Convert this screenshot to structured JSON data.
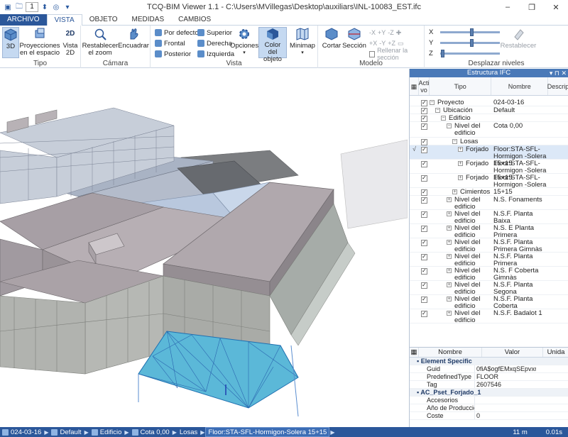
{
  "titlebar": {
    "title": "TCQ-BIM Viewer 1.1 - C:\\Users\\MVillegas\\Desktop\\auxiliars\\INL-10083_EST.ifc",
    "qa_value": "1"
  },
  "tabs": [
    "ARCHIVO",
    "VISTA",
    "OBJETO",
    "MEDIDAS",
    "CAMBIOS"
  ],
  "ribbon": {
    "tipo": {
      "label": "Tipo",
      "b3d": "3D",
      "proyecciones": "Proyecciones en el espacio",
      "vista2d": "Vista 2D",
      "icon2d": "2D"
    },
    "camara": {
      "label": "Cámara",
      "restablecer": "Restablecer el zoom",
      "encuadrar": "Encuadrar"
    },
    "vista": {
      "label": "Vista",
      "por_defecto": "Por defecto",
      "frontal": "Frontal",
      "posterior": "Posterior",
      "superior": "Superior",
      "derecha": "Derecha",
      "izquierda": "Izquierda",
      "opciones": "Opciones",
      "color_objeto": "Color del objeto",
      "minimap": "Minimap"
    },
    "modelo": {
      "label": "Modelo",
      "cortar": "Cortar",
      "seccion": "Sección",
      "x": "+X",
      "y": "+Y",
      "z": "+Z",
      "mx": "-X",
      "my": "-Y",
      "mz": "-Z",
      "rellenar": "Rellenar la sección"
    },
    "desplazar": {
      "label": "Desplazar niveles",
      "x": "X",
      "y": "Y",
      "z": "Z",
      "restablecer": "Restablecer",
      "x_level": 0.52,
      "y_level": 0.52,
      "z_level": 0.02
    }
  },
  "panel": {
    "title": "Estructura IFC",
    "col_activo": "Acti vo",
    "col_tipo": "Tipo",
    "col_nombre": "Nombre",
    "col_desc": "Descrip",
    "rows": [
      {
        "tipo": "Proyecto",
        "nombre": "024-03-16"
      },
      {
        "tipo": "Ubicación",
        "nombre": "Default"
      },
      {
        "tipo": "Edificio",
        "nombre": ""
      },
      {
        "tipo": "Nivel del edificio",
        "nombre": "Cota 0,00"
      },
      {
        "tipo": "Losas",
        "nombre": ""
      },
      {
        "tipo": "Forjado",
        "nombre": "Floor:STA-SFL-Hormigon -Solera 15+15"
      },
      {
        "tipo": "Forjado",
        "nombre": "Floor:STA-SFL-Hormigon -Solera 15+15"
      },
      {
        "tipo": "Forjado",
        "nombre": "Floor:STA-SFL-Hormigon -Solera 15+15"
      },
      {
        "tipo": "Cimientos",
        "nombre": ""
      },
      {
        "tipo": "Nivel del edificio",
        "nombre": "N.S. Fonaments"
      },
      {
        "tipo": "Nivel del edificio",
        "nombre": "N.S.F. Planta Baixa"
      },
      {
        "tipo": "Nivel del edificio",
        "nombre": "N.S. E Planta Primera"
      },
      {
        "tipo": "Nivel del edificio",
        "nombre": "N.S.F. Planta Primera Gimnàs"
      },
      {
        "tipo": "Nivel del edificio",
        "nombre": "N.S.F. Planta Primera"
      },
      {
        "tipo": "Nivel del edificio",
        "nombre": "N.S. F Coberta Gimnàs"
      },
      {
        "tipo": "Nivel del edificio",
        "nombre": "N.S.F. Planta Segona"
      },
      {
        "tipo": "Nivel del edificio",
        "nombre": "N.S.F. Planta Coberta"
      },
      {
        "tipo": "Nivel del edificio",
        "nombre": "N.S.F. Badalot 1"
      }
    ]
  },
  "props": {
    "col_nombre": "Nombre",
    "col_valor": "Valor",
    "col_unidad": "Unida",
    "cat1": "Element Specific",
    "guid_label": "Guid",
    "guid_value": "0fiA$ogfEMxqSEpvxrA9I",
    "predef_label": "PredefinedType",
    "predef_value": "FLOOR",
    "tag_label": "Tag",
    "tag_value": "2607546",
    "cat2": "AC_Pset_Forjado_1",
    "accesorios_label": "Accesorios",
    "anio_label": "Año de Producción",
    "coste_label": "Coste",
    "coste_value": "0"
  },
  "status": {
    "crumbs": [
      "024-03-16",
      "Default",
      "Edificio",
      "Cota 0,00",
      "Losas",
      "Floor:STA-SFL-Hormigon-Solera 15+15"
    ],
    "scale": "11 m",
    "time": "0.01s"
  },
  "colors": {
    "accent": "#2b579a",
    "selection": "#5bb8d8"
  }
}
